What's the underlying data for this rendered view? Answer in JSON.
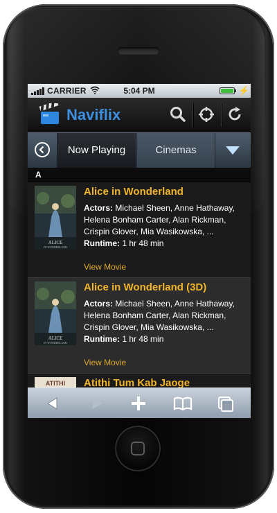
{
  "status_bar": {
    "carrier": "CARRIER",
    "time": "5:04 PM"
  },
  "header": {
    "app_name": "Naviflix"
  },
  "tabs": {
    "active": "Now Playing",
    "inactive": "Cinemas"
  },
  "section_letter": "A",
  "movies": [
    {
      "title": "Alice in Wonderland",
      "actors_label": "Actors:",
      "actors": "Michael Sheen, Anne Hathaway, Helena Bonham Carter, Alan Rickman, Crispin Glover, Mia Wasikowska, ...",
      "runtime_label": "Runtime:",
      "runtime": "1 hr 48 min",
      "link": "View Movie"
    },
    {
      "title": "Alice in Wonderland (3D)",
      "actors_label": "Actors:",
      "actors": "Michael Sheen, Anne Hathaway, Helena Bonham Carter, Alan Rickman, Crispin Glover, Mia Wasikowska, ...",
      "runtime_label": "Runtime:",
      "runtime": "1 hr 48 min",
      "link": "View Movie"
    },
    {
      "title": "Atithi Tum Kab Jaoge"
    }
  ],
  "colors": {
    "title_accent": "#f3b52a",
    "logo_blue": "#3d8fe0",
    "tab_bar": "#3c4856"
  },
  "icons": [
    "search-icon",
    "locate-icon",
    "refresh-icon",
    "back-circle-icon",
    "dropdown-triangle-icon",
    "back-arrow-icon",
    "forward-arrow-icon",
    "plus-icon",
    "bookmarks-icon",
    "pages-icon"
  ]
}
